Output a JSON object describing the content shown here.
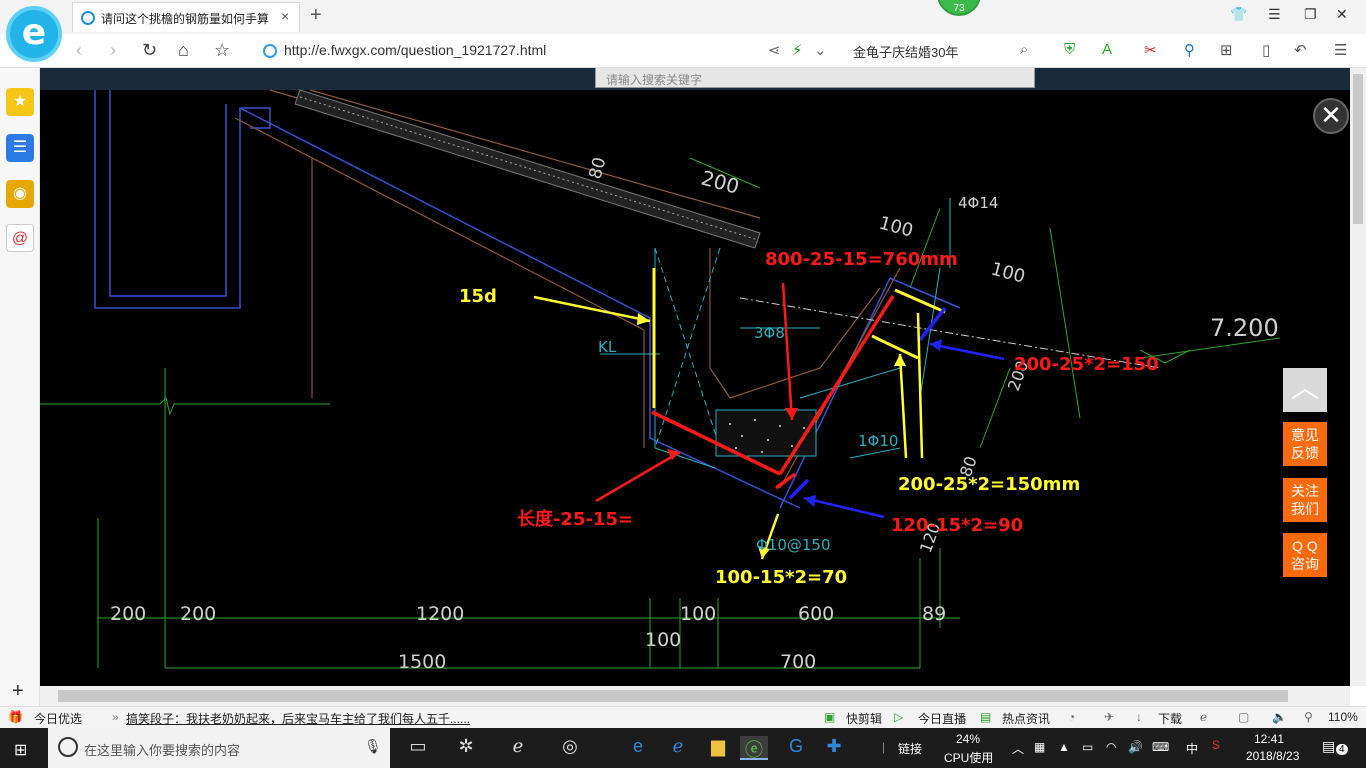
{
  "browser": {
    "tab_title": "请问这个挑檐的钢筋量如何手算",
    "tab_close": "×",
    "new_tab": "+",
    "badge_count": "73",
    "url": "http://e.fwxgx.com/question_1921727.html",
    "search_value": "金龟子庆结婚30年",
    "logo_letter": "e"
  },
  "page": {
    "search_placeholder": "请输入搜索关键字",
    "close_symbol": "✕",
    "back_to_top": "︿",
    "side_buttons": [
      {
        "line1": "意见",
        "line2": "反馈"
      },
      {
        "line1": "关注",
        "line2": "我们"
      },
      {
        "line1": "Q Q",
        "line2": "咨询"
      }
    ]
  },
  "drawing": {
    "cad_labels": {
      "d200_top": "200",
      "d80": "80",
      "d100_a": "100",
      "d100_b": "100",
      "rebar_4phi14": "4Φ14",
      "kl": "KL",
      "rebar_3phi8": "3Φ8",
      "rebar_1phi10": "1Φ10",
      "rebar_phi10_150": "Φ10@150",
      "elevation": "7.200",
      "d200_side": "200",
      "d80_side": "80",
      "d120": "120"
    },
    "dimensions_bottom": [
      "200",
      "200",
      "1200",
      "100",
      "600",
      "89"
    ],
    "dimension_100_lower": "100",
    "dimension_1500": "1500",
    "dimension_700": "700",
    "annotations": {
      "a_15d": "15d",
      "a_760": "800-25-15=760mm",
      "a_150_right": "200-25*2=150",
      "a_150mm": "200-25*2=150mm",
      "a_90": "120-15*2=90",
      "a_length": "长度-25-15=",
      "a_70": "100-15*2=70"
    }
  },
  "statusbar": {
    "today_pick": "今日优选",
    "news": "搞笑段子：我扶老奶奶起来，后来宝马车主给了我们每人五千......",
    "quick_clip": "快剪辑",
    "live": "今日直播",
    "hot_news": "热点资讯",
    "download": "下载",
    "zoom": "110%"
  },
  "taskbar": {
    "search_placeholder": "在这里输入你要搜索的内容",
    "link_label": "链接",
    "cpu_percent": "24%",
    "cpu_label": "CPU使用",
    "ime": "中",
    "time": "12:41",
    "date": "2018/8/23",
    "notifications": "4"
  },
  "colors": {
    "accent_orange": "#ff6a0c",
    "cad_green": "#2ea52e",
    "annotation_red": "#ff1a1a",
    "annotation_yellow": "#ffff33",
    "annotation_blue": "#2222ff"
  }
}
